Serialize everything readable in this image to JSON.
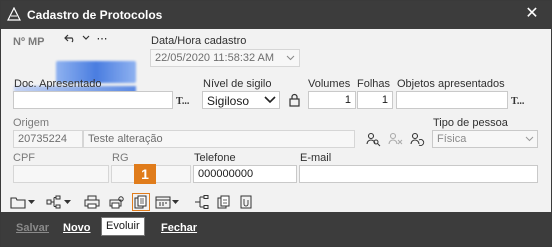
{
  "window": {
    "title": "Cadastro de Protocolos"
  },
  "fields": {
    "mp_label": "Nº MP",
    "data_hora_label": "Data/Hora cadastro",
    "data_hora_value": "22/05/2020 11:58:32 AM",
    "doc_label": "Doc. Apresentado",
    "doc_value": "",
    "nivel_label": "Nível de sigilo",
    "nivel_value": "Sigiloso",
    "volumes_label": "Volumes",
    "volumes_value": "1",
    "folhas_label": "Folhas",
    "folhas_value": "1",
    "objetos_label": "Objetos apresentados",
    "objetos_value": "",
    "origem_label": "Origem",
    "origem_code": "20735224",
    "origem_name": "Teste alteração",
    "tipo_pessoa_label": "Tipo de pessoa",
    "tipo_pessoa_value": "Física",
    "cpf_label": "CPF",
    "rg_label": "RG",
    "telefone_label": "Telefone",
    "telefone_value": "000000000",
    "email_label": "E-mail",
    "t_mark": "T..."
  },
  "bottom_bar": {
    "salvar": "Salvar",
    "novo": "Novo",
    "evoluir": "Evoluir",
    "fechar": "Fechar"
  },
  "annotation": {
    "badge": "1"
  },
  "tooltip": {
    "text": "Evoluir"
  },
  "colors": {
    "titlebar": "#3c3c3c",
    "badge": "#e07c1b",
    "mp_blur": "#4a7de0"
  }
}
